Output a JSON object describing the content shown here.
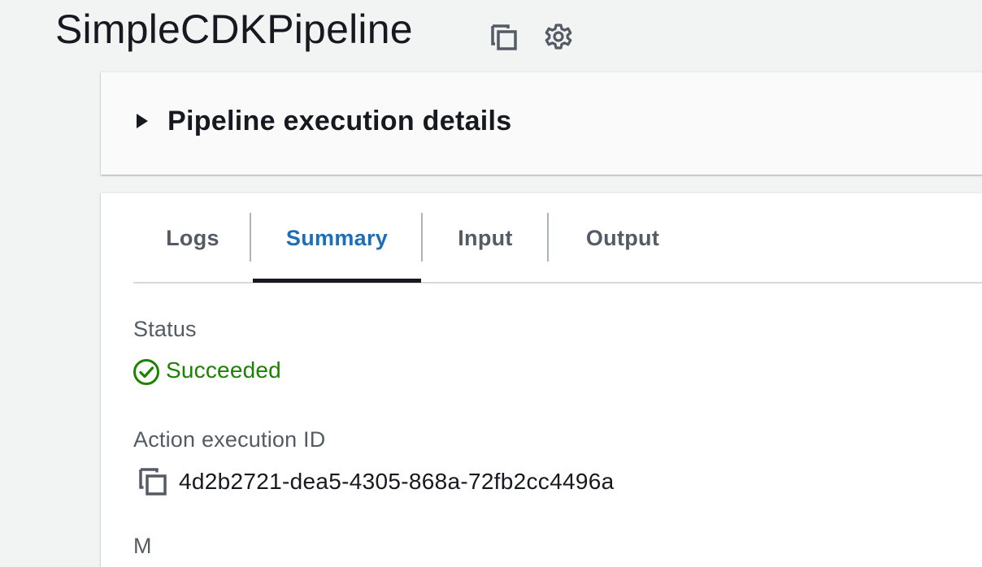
{
  "page": {
    "title": "SimpleCDKPipeline",
    "icons": {
      "copy": "copy-icon",
      "settings": "gear-icon"
    }
  },
  "details_panel": {
    "heading": "Pipeline execution details",
    "expand_icon": "caret-right-icon"
  },
  "tabs": [
    {
      "label": "Logs",
      "active": false
    },
    {
      "label": "Summary",
      "active": true
    },
    {
      "label": "Input",
      "active": false
    },
    {
      "label": "Output",
      "active": false
    }
  ],
  "summary": {
    "status_label": "Status",
    "status_value": "Succeeded",
    "status_icon": "check-circle-icon",
    "execution_id_label": "Action execution ID",
    "execution_id": "4d2b2721-dea5-4305-868a-72fb2cc4496a",
    "partial_next_label": "M"
  },
  "colors": {
    "active_tab": "#1d6eb9",
    "success": "#1d8102",
    "text": "#16191f",
    "muted_text": "#545b64",
    "background": "#f2f3f3"
  }
}
